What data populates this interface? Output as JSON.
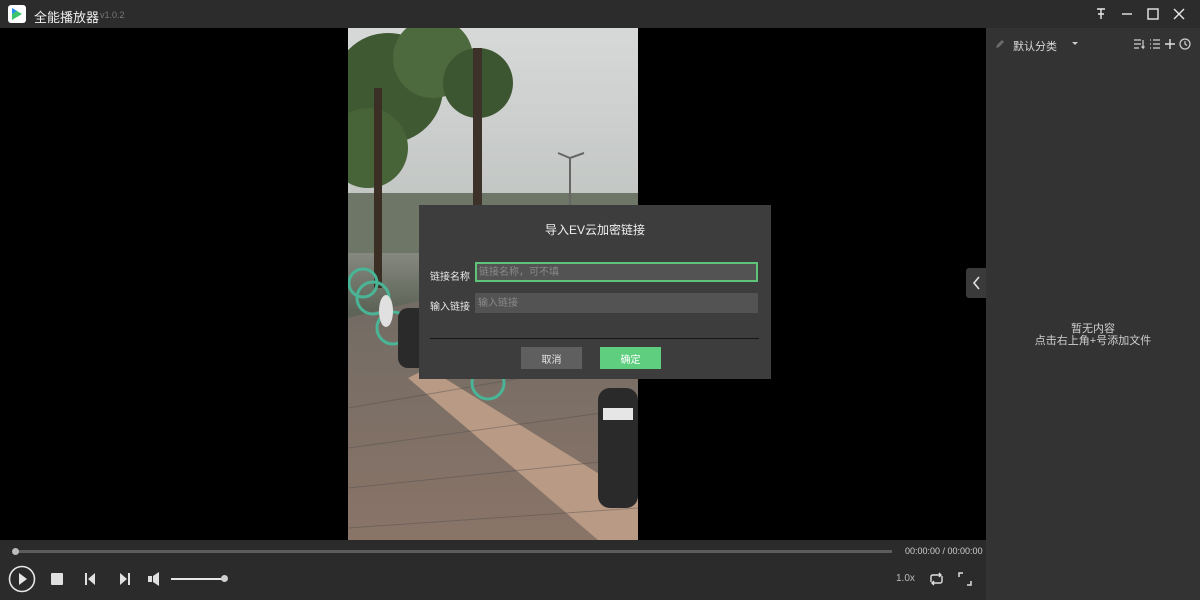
{
  "window": {
    "title": "全能播放器",
    "version": "v1.0.2",
    "controls": [
      "pin-icon",
      "minimize-icon",
      "maximize-icon",
      "close-icon"
    ]
  },
  "sidebar": {
    "category": "默认分类",
    "tools": [
      "sort-icon",
      "list-icon",
      "add-icon",
      "history-icon"
    ],
    "empty_title": "暂无内容",
    "empty_hint": "点击右上角+号添加文件"
  },
  "dialog": {
    "title": "导入EV云加密链接",
    "name_label": "链接名称",
    "name_placeholder": "链接名称，可不填",
    "name_value": "",
    "url_label": "输入链接",
    "url_placeholder": "输入链接",
    "url_value": "",
    "cancel_label": "取消",
    "ok_label": "确定"
  },
  "player": {
    "time": "00:00:00 / 00:00:00",
    "progress": 0,
    "volume": 1.0,
    "speed": "1.0x"
  },
  "colors": {
    "accent": "#5fcf7f",
    "background": "#1f1f1f",
    "panel": "#333333"
  }
}
